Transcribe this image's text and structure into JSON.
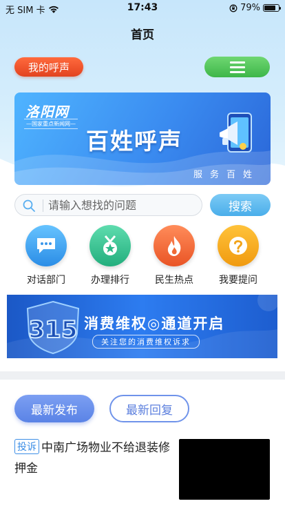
{
  "status_bar": {
    "carrier": "无 SIM 卡",
    "time": "17:43",
    "battery_text": "79%",
    "battery_level": 0.79
  },
  "nav": {
    "title": "首页"
  },
  "header": {
    "my_voice_label": "我的呼声"
  },
  "banner": {
    "brand": "洛阳网",
    "brand_sub": "—国家重点新闻网—",
    "title": "百姓呼声",
    "subtitle": "服务百姓"
  },
  "search": {
    "placeholder": "请输入想找的问题",
    "button_label": "搜索"
  },
  "quick_links": [
    {
      "label": "对话部门",
      "icon": "chat-bubble-icon",
      "color": "#3fa6ee"
    },
    {
      "label": "办理排行",
      "icon": "medal-icon",
      "color": "#33c28f"
    },
    {
      "label": "民生热点",
      "icon": "flame-icon",
      "color": "#f2693a"
    },
    {
      "label": "我要提问",
      "icon": "question-icon",
      "color": "#f5a31a"
    }
  ],
  "promo": {
    "logo_text": "315",
    "title": "消费维权◎通道开启",
    "subtitle": "关注您的消费维权诉求"
  },
  "tabs": [
    {
      "label": "最新发布",
      "active": true
    },
    {
      "label": "最新回复",
      "active": false
    }
  ],
  "items": [
    {
      "tag": "投诉",
      "title": "中南广场物业不给退装修押金"
    }
  ]
}
